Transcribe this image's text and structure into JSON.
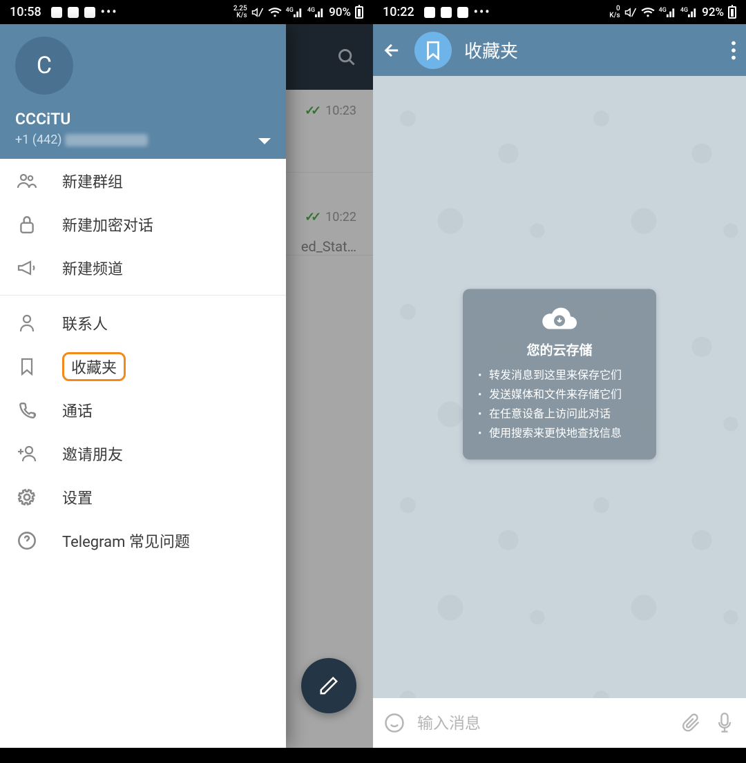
{
  "left": {
    "statusbar": {
      "time": "10:58",
      "speed_top": "2.25",
      "speed_bot": "K/s",
      "net1": "4G",
      "net2": "4G",
      "battery": "90%"
    },
    "drawer": {
      "avatar_letter": "C",
      "account_name": "CCCiTU",
      "phone_prefix": "+1 (442)",
      "items": [
        {
          "icon": "group",
          "label": "新建群组"
        },
        {
          "icon": "lock",
          "label": "新建加密对话"
        },
        {
          "icon": "megaphone",
          "label": "新建频道"
        }
      ],
      "items2": [
        {
          "icon": "person",
          "label": "联系人"
        },
        {
          "icon": "bookmark",
          "label": "收藏夹",
          "highlighted": true
        },
        {
          "icon": "phone",
          "label": "通话"
        },
        {
          "icon": "invite",
          "label": "邀请朋友"
        },
        {
          "icon": "gear",
          "label": "设置"
        },
        {
          "icon": "help",
          "label": "Telegram 常见问题"
        }
      ]
    },
    "behind": {
      "row1_time": "10:23",
      "row2_time": "10:22",
      "row2_snippet": "ed_Stat…"
    }
  },
  "right": {
    "statusbar": {
      "time": "10:22",
      "speed_top": "0",
      "speed_bot": "K/s",
      "net1": "4G",
      "net2": "4G",
      "battery": "92%"
    },
    "header_title": "收藏夹",
    "tip": {
      "title": "您的云存储",
      "bullets": [
        "转发消息到这里来保存它们",
        "发送媒体和文件来存储它们",
        "在任意设备上访问此对话",
        "使用搜索来更快地查找信息"
      ]
    },
    "input_placeholder": "输入消息"
  }
}
